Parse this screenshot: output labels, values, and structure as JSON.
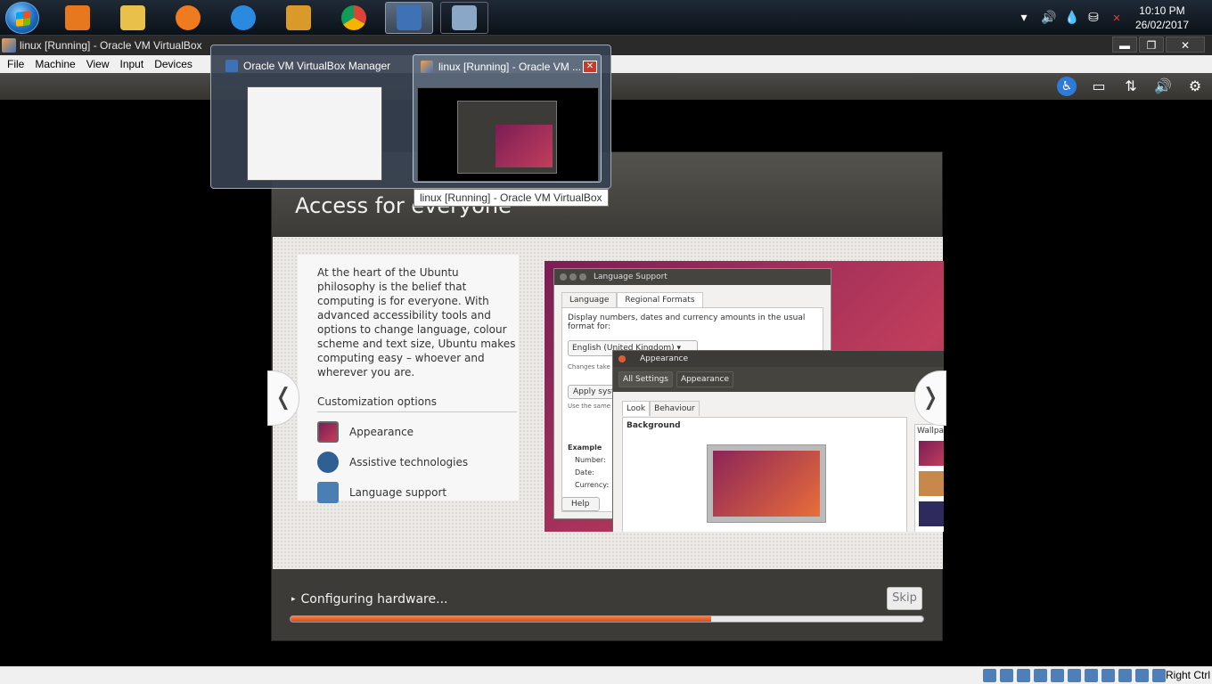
{
  "taskbar": {
    "apps": [
      {
        "icon": "media-player-icon",
        "color": "#e8781e"
      },
      {
        "icon": "file-explorer-icon",
        "color": "#e8c04a"
      },
      {
        "icon": "uc-browser-icon",
        "color": "#f07a1e"
      },
      {
        "icon": "internet-explorer-icon",
        "color": "#2a8ae0"
      },
      {
        "icon": "word-icon",
        "color": "#d99a2a"
      },
      {
        "icon": "chrome-icon",
        "color": "#4caf50"
      },
      {
        "icon": "virtualbox-icon",
        "color": "#3e71b6"
      },
      {
        "icon": "paint-icon",
        "color": "#8aa7c8"
      }
    ],
    "tray": [
      "▾",
      "🔊",
      "💧",
      "⛁",
      "✕"
    ],
    "time": "10:10 PM",
    "date": "26/02/2017"
  },
  "window": {
    "title": "linux [Running] - Oracle VM VirtualBox",
    "minimize": "▬",
    "restore": "❐",
    "close": "✕"
  },
  "menu": [
    "File",
    "Machine",
    "View",
    "Input",
    "Devices"
  ],
  "vm_toolbar": [
    "accessibility-icon",
    "battery-icon",
    "network-icon",
    "volume-icon",
    "settings-icon"
  ],
  "vm_toolbar_glyphs": [
    "♿",
    "▭",
    "⇅",
    "🔊",
    "⚙"
  ],
  "installer": {
    "title": "Access for everyone",
    "description": "At the heart of the Ubuntu philosophy is the belief that computing is for everyone. With advanced accessibility tools and options to change language, colour scheme and text size, Ubuntu makes computing easy – whoever and wherever you are.",
    "customization_title": "Customization options",
    "options": [
      "Appearance",
      "Assistive technologies",
      "Language support"
    ],
    "nav_prev": "❬",
    "nav_next": "❭",
    "status": "Configuring hardware...",
    "skip": "Skip",
    "progress": 0.665
  },
  "screenshot": {
    "lang_title": "Language Support",
    "lang_tabs": [
      "Language",
      "Regional Formats"
    ],
    "lang_desc": "Display numbers, dates and currency amounts in the usual format for:",
    "lang_value": "English (United Kingdom)",
    "lang_changes": "Changes take e",
    "apply": "Apply syste",
    "use_same": "Use the same fo",
    "example_label": "Example",
    "example_fields": [
      "Number:",
      "Date:",
      "Currency:"
    ],
    "help": "Help",
    "app_title": "Appearance",
    "app_bar": [
      "All Settings",
      "Appearance"
    ],
    "look_tabs": [
      "Look",
      "Behaviour"
    ],
    "background": "Background",
    "wallpaper": "Wallpap"
  },
  "popup": {
    "thumb1_title": "Oracle VM VirtualBox Manager",
    "thumb2_title": "linux [Running] - Oracle VM ...",
    "tooltip": "linux [Running] - Oracle VM VirtualBox"
  },
  "statusbar": {
    "host_key": "Right Ctrl"
  }
}
